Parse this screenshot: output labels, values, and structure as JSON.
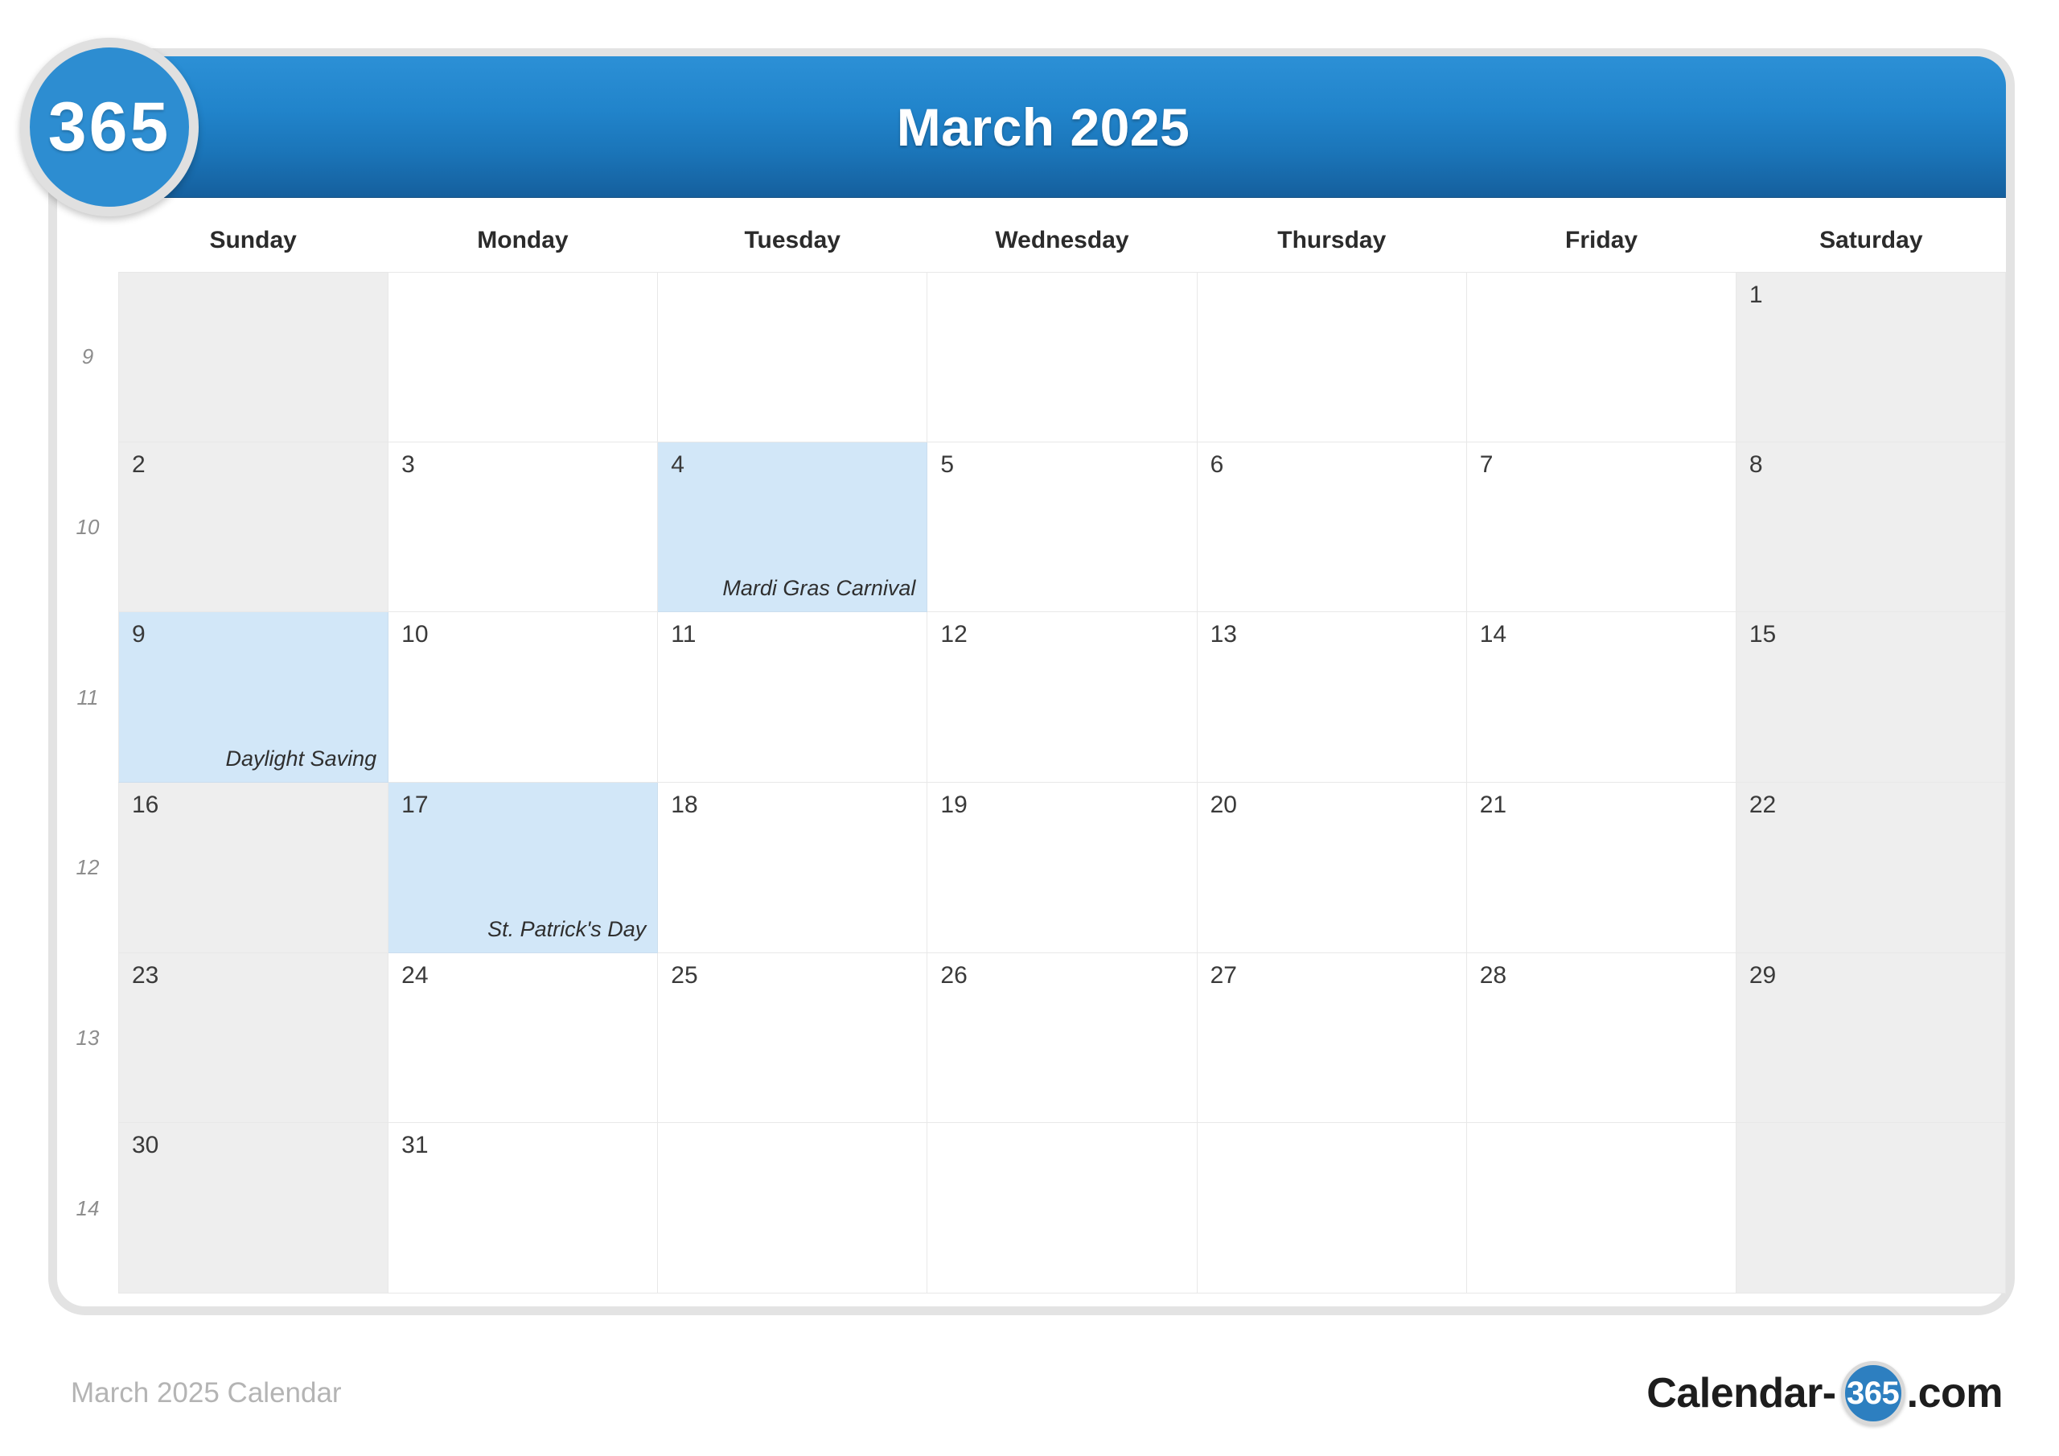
{
  "brand": {
    "badge_text": "365",
    "footer_logo_prefix": "Calendar-",
    "footer_logo_circle": "365",
    "footer_logo_suffix": ".com"
  },
  "header": {
    "title": "March 2025"
  },
  "footer": {
    "caption": "March 2025 Calendar"
  },
  "watermark": {
    "text": "365"
  },
  "weekdays": [
    "Sunday",
    "Monday",
    "Tuesday",
    "Wednesday",
    "Thursday",
    "Friday",
    "Saturday"
  ],
  "colors": {
    "header_blue_top": "#2c90d6",
    "header_blue_bottom": "#155f9d",
    "event_highlight": "#d2e7f8",
    "weekend_bg": "#eeeeee",
    "grid_line": "#e8e8e8",
    "frame_border": "#e3e3e3",
    "badge_blue": "#2d8dd1",
    "week_number_text": "#8d8d8d",
    "footer_caption_text": "#b4b4b4"
  },
  "weeks": [
    {
      "week_number": "9",
      "days": [
        {
          "num": "",
          "event": "",
          "weekend": true,
          "highlight": false
        },
        {
          "num": "",
          "event": "",
          "weekend": false,
          "highlight": false
        },
        {
          "num": "",
          "event": "",
          "weekend": false,
          "highlight": false
        },
        {
          "num": "",
          "event": "",
          "weekend": false,
          "highlight": false
        },
        {
          "num": "",
          "event": "",
          "weekend": false,
          "highlight": false
        },
        {
          "num": "",
          "event": "",
          "weekend": false,
          "highlight": false
        },
        {
          "num": "1",
          "event": "",
          "weekend": true,
          "highlight": false
        }
      ]
    },
    {
      "week_number": "10",
      "days": [
        {
          "num": "2",
          "event": "",
          "weekend": true,
          "highlight": false
        },
        {
          "num": "3",
          "event": "",
          "weekend": false,
          "highlight": false
        },
        {
          "num": "4",
          "event": "Mardi Gras Carnival",
          "weekend": false,
          "highlight": true
        },
        {
          "num": "5",
          "event": "",
          "weekend": false,
          "highlight": false
        },
        {
          "num": "6",
          "event": "",
          "weekend": false,
          "highlight": false
        },
        {
          "num": "7",
          "event": "",
          "weekend": false,
          "highlight": false
        },
        {
          "num": "8",
          "event": "",
          "weekend": true,
          "highlight": false
        }
      ]
    },
    {
      "week_number": "11",
      "days": [
        {
          "num": "9",
          "event": "Daylight Saving",
          "weekend": true,
          "highlight": true
        },
        {
          "num": "10",
          "event": "",
          "weekend": false,
          "highlight": false
        },
        {
          "num": "11",
          "event": "",
          "weekend": false,
          "highlight": false
        },
        {
          "num": "12",
          "event": "",
          "weekend": false,
          "highlight": false
        },
        {
          "num": "13",
          "event": "",
          "weekend": false,
          "highlight": false
        },
        {
          "num": "14",
          "event": "",
          "weekend": false,
          "highlight": false
        },
        {
          "num": "15",
          "event": "",
          "weekend": true,
          "highlight": false
        }
      ]
    },
    {
      "week_number": "12",
      "days": [
        {
          "num": "16",
          "event": "",
          "weekend": true,
          "highlight": false
        },
        {
          "num": "17",
          "event": "St. Patrick's Day",
          "weekend": false,
          "highlight": true
        },
        {
          "num": "18",
          "event": "",
          "weekend": false,
          "highlight": false
        },
        {
          "num": "19",
          "event": "",
          "weekend": false,
          "highlight": false
        },
        {
          "num": "20",
          "event": "",
          "weekend": false,
          "highlight": false
        },
        {
          "num": "21",
          "event": "",
          "weekend": false,
          "highlight": false
        },
        {
          "num": "22",
          "event": "",
          "weekend": true,
          "highlight": false
        }
      ]
    },
    {
      "week_number": "13",
      "days": [
        {
          "num": "23",
          "event": "",
          "weekend": true,
          "highlight": false
        },
        {
          "num": "24",
          "event": "",
          "weekend": false,
          "highlight": false
        },
        {
          "num": "25",
          "event": "",
          "weekend": false,
          "highlight": false
        },
        {
          "num": "26",
          "event": "",
          "weekend": false,
          "highlight": false
        },
        {
          "num": "27",
          "event": "",
          "weekend": false,
          "highlight": false
        },
        {
          "num": "28",
          "event": "",
          "weekend": false,
          "highlight": false
        },
        {
          "num": "29",
          "event": "",
          "weekend": true,
          "highlight": false
        }
      ]
    },
    {
      "week_number": "14",
      "days": [
        {
          "num": "30",
          "event": "",
          "weekend": true,
          "highlight": false
        },
        {
          "num": "31",
          "event": "",
          "weekend": false,
          "highlight": false
        },
        {
          "num": "",
          "event": "",
          "weekend": false,
          "highlight": false
        },
        {
          "num": "",
          "event": "",
          "weekend": false,
          "highlight": false
        },
        {
          "num": "",
          "event": "",
          "weekend": false,
          "highlight": false
        },
        {
          "num": "",
          "event": "",
          "weekend": false,
          "highlight": false
        },
        {
          "num": "",
          "event": "",
          "weekend": true,
          "highlight": false
        }
      ]
    }
  ]
}
